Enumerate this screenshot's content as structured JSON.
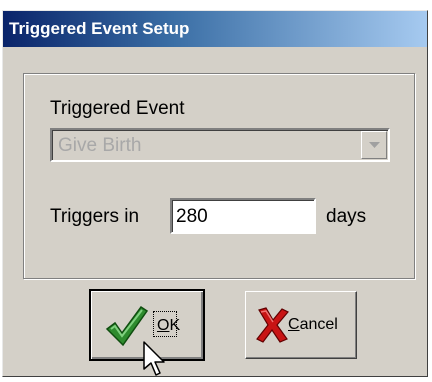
{
  "dialog": {
    "title": "Triggered Event Setup"
  },
  "triggered_event": {
    "label": "Triggered Event",
    "selected_value": "Give Birth",
    "enabled": false
  },
  "triggers": {
    "label": "Triggers in",
    "value": "280",
    "unit_label": "days"
  },
  "buttons": {
    "ok": {
      "mnemonic": "O",
      "rest": "K",
      "icon": "checkmark-icon"
    },
    "cancel": {
      "mnemonic": "C",
      "rest": "ancel",
      "icon": "red-x-icon"
    }
  },
  "colors": {
    "titlebar_start": "#0a246a",
    "titlebar_end": "#a6caf0",
    "face": "#d4d0c8",
    "check_green": "#2e8b2e",
    "cancel_red": "#c81414"
  }
}
